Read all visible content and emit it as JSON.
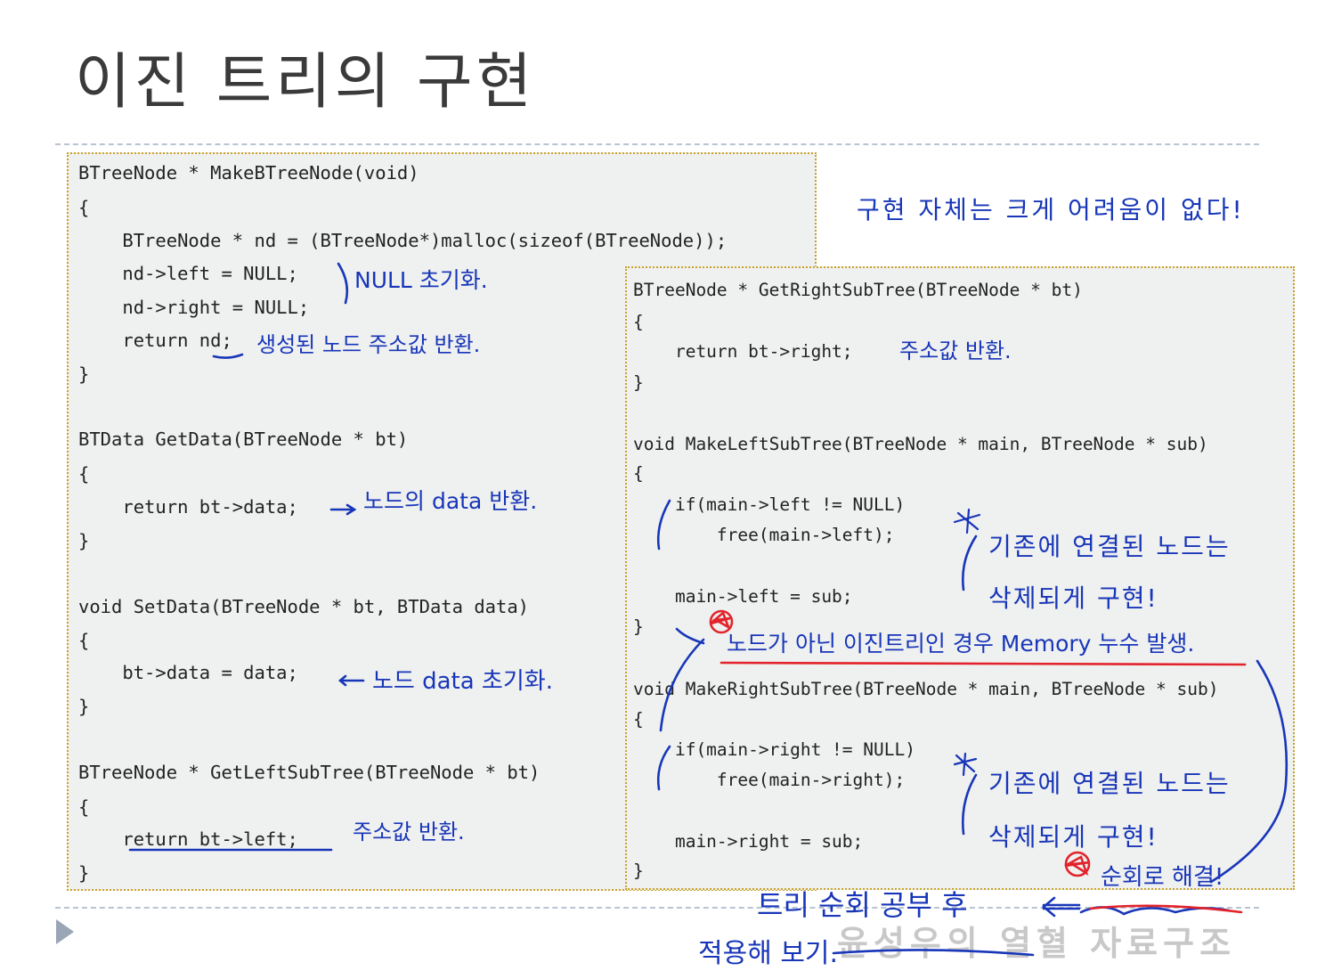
{
  "slide": {
    "title": "이진 트리의 구현",
    "footer": "윤성우의 열혈 자료구조"
  },
  "left_code": [
    "BTreeNode * MakeBTreeNode(void)",
    "{",
    "    BTreeNode * nd = (BTreeNode*)malloc(sizeof(BTreeNode));",
    "    nd->left = NULL;",
    "    nd->right = NULL;",
    "    return nd;",
    "}",
    "BTData GetData(BTreeNode * bt)",
    "{",
    "    return bt->data;",
    "}",
    "void SetData(BTreeNode * bt, BTData data)",
    "{",
    "    bt->data = data;",
    "}",
    "BTreeNode * GetLeftSubTree(BTreeNode * bt)",
    "{",
    "    return bt->left;",
    "}"
  ],
  "right_code": [
    "BTreeNode * GetRightSubTree(BTreeNode * bt)",
    "{",
    "    return bt->right;",
    "}",
    "void MakeLeftSubTree(BTreeNode * main, BTreeNode * sub)",
    "{",
    "    if(main->left != NULL)",
    "        free(main->left);",
    "    main->left = sub;",
    "}",
    "void MakeRightSubTree(BTreeNode * main, BTreeNode * sub)",
    "{",
    "    if(main->right != NULL)",
    "        free(main->right);",
    "    main->right = sub;",
    "}"
  ],
  "annotations": {
    "top_note": "구현 자체는 크게 어려움이 없다!",
    "null_init": "NULL 초기화.",
    "return_nd": "생성된 노드 주소값 반환.",
    "getdata": "노드의 data 반환.",
    "setdata": "노드 data 초기화.",
    "getleft": "주소값 반환.",
    "getright": "주소값 반환.",
    "left_existing_1": "기존에 연결된 노드는",
    "left_existing_2": "삭제되게 구현!",
    "memory_leak": "노드가 아닌 이진트리인 경우 Memory 누수 발생.",
    "right_existing_1": "기존에 연결된 노드는",
    "right_existing_2": "삭제되게 구현!",
    "solve": "순회로 해결!",
    "traversal": "트리 순회 공부 후",
    "apply": "적용해 보기."
  },
  "colors": {
    "ink_blue": "#1836b8",
    "ink_red": "#e3232b",
    "box_border": "#c9a227",
    "box_fill": "#eff0f0"
  }
}
